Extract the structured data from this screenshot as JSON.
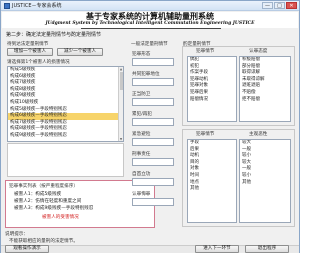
{
  "window": {
    "title": "JUSTICE－专家会系统",
    "buttons": [
      "—",
      "□",
      "✕"
    ]
  },
  "banner": {
    "title_zh": "基于专家系统的计算机辅助量刑系统",
    "title_en": "JUdgment System by Technological Intelligent Commutation Engineering  JUSTICE"
  },
  "step_title": "第二步：确定法定量刑情节与酌定量刑情节",
  "left": {
    "list_label": "待到达法定量刑情节",
    "add_one_button": "增加一个被害人",
    "remove_one_button": "减少一个被害人",
    "list2_label": "请选择第1个被害人的损害情况",
    "items": [
      "构成5级残疾",
      "构成6级残疾",
      "构成7级残疾",
      "构成8级残疾",
      "构成9级残疾",
      "构成10级残疾",
      "构成5级残疾—手段特别残忍",
      "构成6级残疾—手段特别残忍",
      "构成7级残疾—手段特别残忍",
      "构成8级残疾—手段特别残忍",
      "构成9级残疾—手段特别残忍"
    ],
    "selected_index": 7
  },
  "prediction": {
    "header": "犯罪事实列表（按严重程度排序）",
    "lines": [
      "被害人1：构成5级残疾",
      "被害人2：伤情在轻度和重度之间",
      "被害人3：构成9级残疾—手段特别残忍"
    ],
    "note": "被害人的受害情况"
  },
  "middle": {
    "label_top": "一般法定量刑情节",
    "label_1": "犯罪形态",
    "label_2": "共同犯罪地位",
    "label_3": "正当防卫",
    "label_4": "累犯/再犯",
    "label_5": "紧急避险",
    "label_6": "刑事责任",
    "label_7": "自首立功",
    "label_8": "认罪悔罪"
  },
  "right": {
    "label_top": "酌定量刑情节",
    "sub_label_1": "犯罪情节",
    "sub_label_2": "认罪态度",
    "list_a": [
      "偶犯",
      "初犯",
      "作案手段",
      "犯罪动机",
      "犯罪对象",
      "犯罪后果",
      "赔偿情况"
    ],
    "list_b": [
      "积极赔偿",
      "部分赔偿",
      "取得谅解",
      "未取得谅解",
      "退赃退赔",
      "不赔偿",
      "拒不赔偿"
    ],
    "sub_label_3": "犯罪情节",
    "sub_label_4": "主观恶性",
    "list_c": [
      "手段",
      "后果",
      "动机",
      "目的",
      "对象",
      "时间",
      "地点",
      "其他"
    ],
    "list_d": [
      "较大",
      "一般",
      "较小",
      "较大",
      "一般",
      "较小",
      "其他"
    ]
  },
  "explain": {
    "label": "说明提示：",
    "text": "不能获取相应的量刑的法定情节。"
  },
  "footer": {
    "left_button": "观看操作演示",
    "next_button": "进入下一环节",
    "exit_button": "退出程序"
  }
}
